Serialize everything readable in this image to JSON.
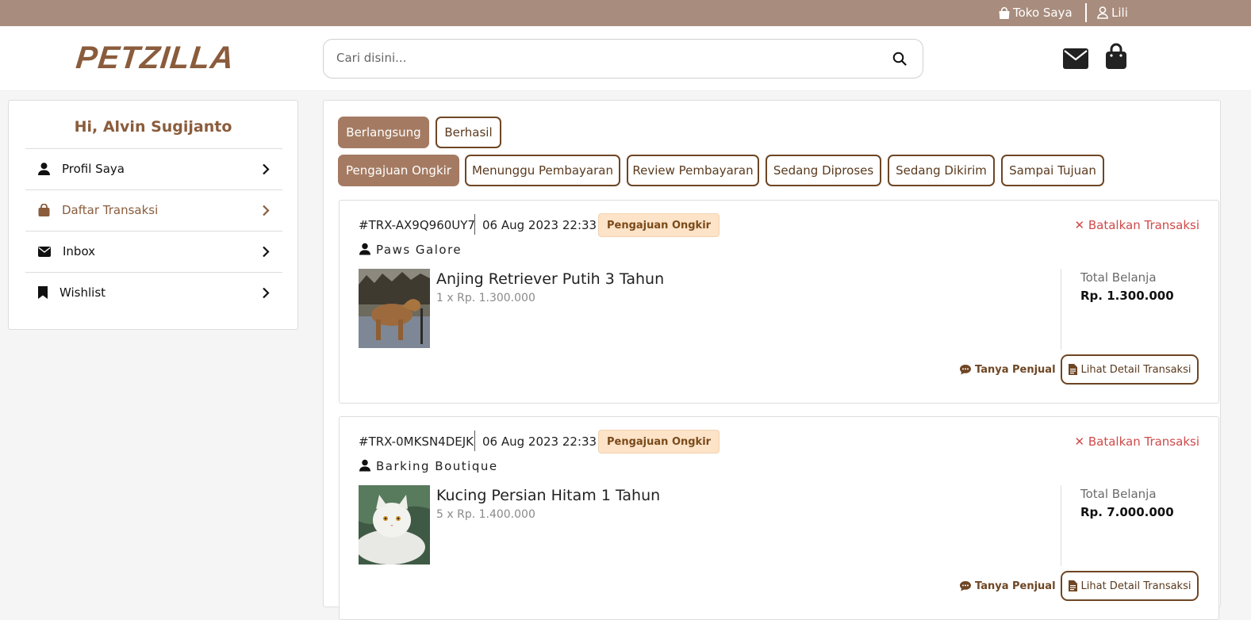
{
  "topbar": {
    "store_label": "Toko Saya",
    "user_label": "Lili"
  },
  "header": {
    "logo": "PETZILLA",
    "search_placeholder": "Cari disini...",
    "icons": [
      "envelope-icon",
      "shopping-bag-icon"
    ]
  },
  "sidebar": {
    "greeting": "Hi, Alvin Sugijanto",
    "items": [
      {
        "label": "Profil Saya",
        "icon": "user-icon",
        "active": false
      },
      {
        "label": "Daftar Transaksi",
        "icon": "shopping-bag-icon",
        "active": true
      },
      {
        "label": "Inbox",
        "icon": "envelope-icon",
        "active": false
      },
      {
        "label": "Wishlist",
        "icon": "bookmark-icon",
        "active": false
      }
    ]
  },
  "main": {
    "status_tabs": [
      "Berlangsung",
      "Berhasil"
    ],
    "stage_tabs": [
      "Pengajuan Ongkir",
      "Menunggu Pembayaran",
      "Review Pembayaran",
      "Sedang Diproses",
      "Sedang Dikirim",
      "Sampai Tujuan"
    ],
    "transactions": [
      {
        "id": "#TRX-AX9Q960UY7",
        "date": "06 Aug 2023 22:33",
        "status": "Pengajuan Ongkir",
        "cancel_label": "Batalkan Transaksi",
        "shop": "Paws Galore",
        "product": "Anjing Retriever Putih 3 Tahun",
        "qty_price": "1 x Rp. 1.300.000",
        "total_label": "Total Belanja",
        "total": "Rp. 1.300.000",
        "ask_label": "Tanya Penjual",
        "detail_label": "Lihat Detail Transaksi"
      },
      {
        "id": "#TRX-0MKSN4DEJK",
        "date": "06 Aug 2023 22:33",
        "status": "Pengajuan Ongkir",
        "cancel_label": "Batalkan Transaksi",
        "shop": "Barking Boutique",
        "product": "Kucing Persian Hitam 1 Tahun",
        "qty_price": "5 x Rp. 1.400.000",
        "total_label": "Total Belanja",
        "total": "Rp. 7.000.000",
        "ask_label": "Tanya Penjual",
        "detail_label": "Lihat Detail Transaksi"
      }
    ]
  },
  "colors": {
    "brand": "#8a5c3c",
    "topbar": "#a88c7d",
    "pill_active": "#a47b62",
    "badge_bg": "#fde3c8",
    "cancel": "#d04a4a"
  }
}
